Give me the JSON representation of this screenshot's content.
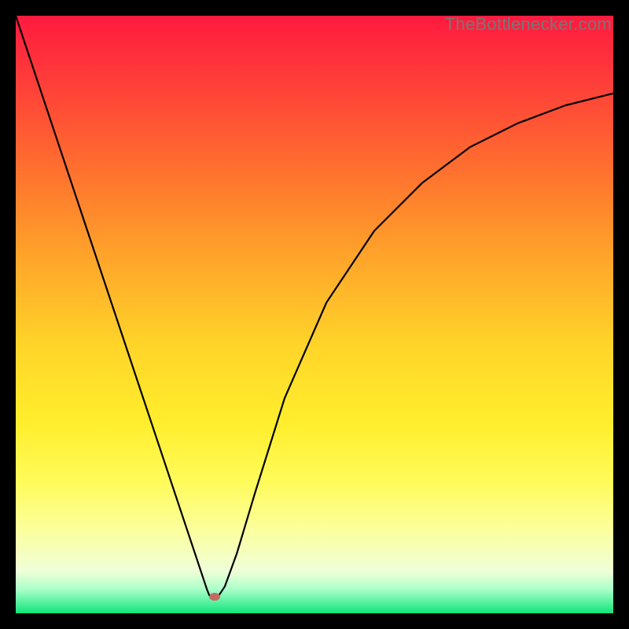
{
  "watermark": {
    "text": "TheBottlenecker.com"
  },
  "chart_data": {
    "type": "line",
    "title": "",
    "xlabel": "",
    "ylabel": "",
    "xlim": [
      0,
      1
    ],
    "ylim": [
      0,
      1
    ],
    "x": [
      0.0,
      0.02,
      0.06,
      0.12,
      0.18,
      0.24,
      0.28,
      0.305,
      0.315,
      0.32,
      0.324,
      0.33,
      0.335,
      0.34,
      0.35,
      0.37,
      0.4,
      0.45,
      0.52,
      0.6,
      0.68,
      0.76,
      0.84,
      0.92,
      1.0
    ],
    "y": [
      1.0,
      0.94,
      0.82,
      0.64,
      0.46,
      0.28,
      0.16,
      0.085,
      0.055,
      0.04,
      0.03,
      0.028,
      0.028,
      0.03,
      0.045,
      0.1,
      0.2,
      0.36,
      0.52,
      0.64,
      0.72,
      0.78,
      0.82,
      0.85,
      0.87
    ],
    "marker": {
      "x": 0.333,
      "y": 0.028
    },
    "gradient_stops": [
      {
        "pos": 0.0,
        "color": "#ff1a3f"
      },
      {
        "pos": 0.4,
        "color": "#ffa32a"
      },
      {
        "pos": 0.7,
        "color": "#ffee2c"
      },
      {
        "pos": 0.95,
        "color": "#aaffc9"
      },
      {
        "pos": 1.0,
        "color": "#11e57a"
      }
    ]
  }
}
